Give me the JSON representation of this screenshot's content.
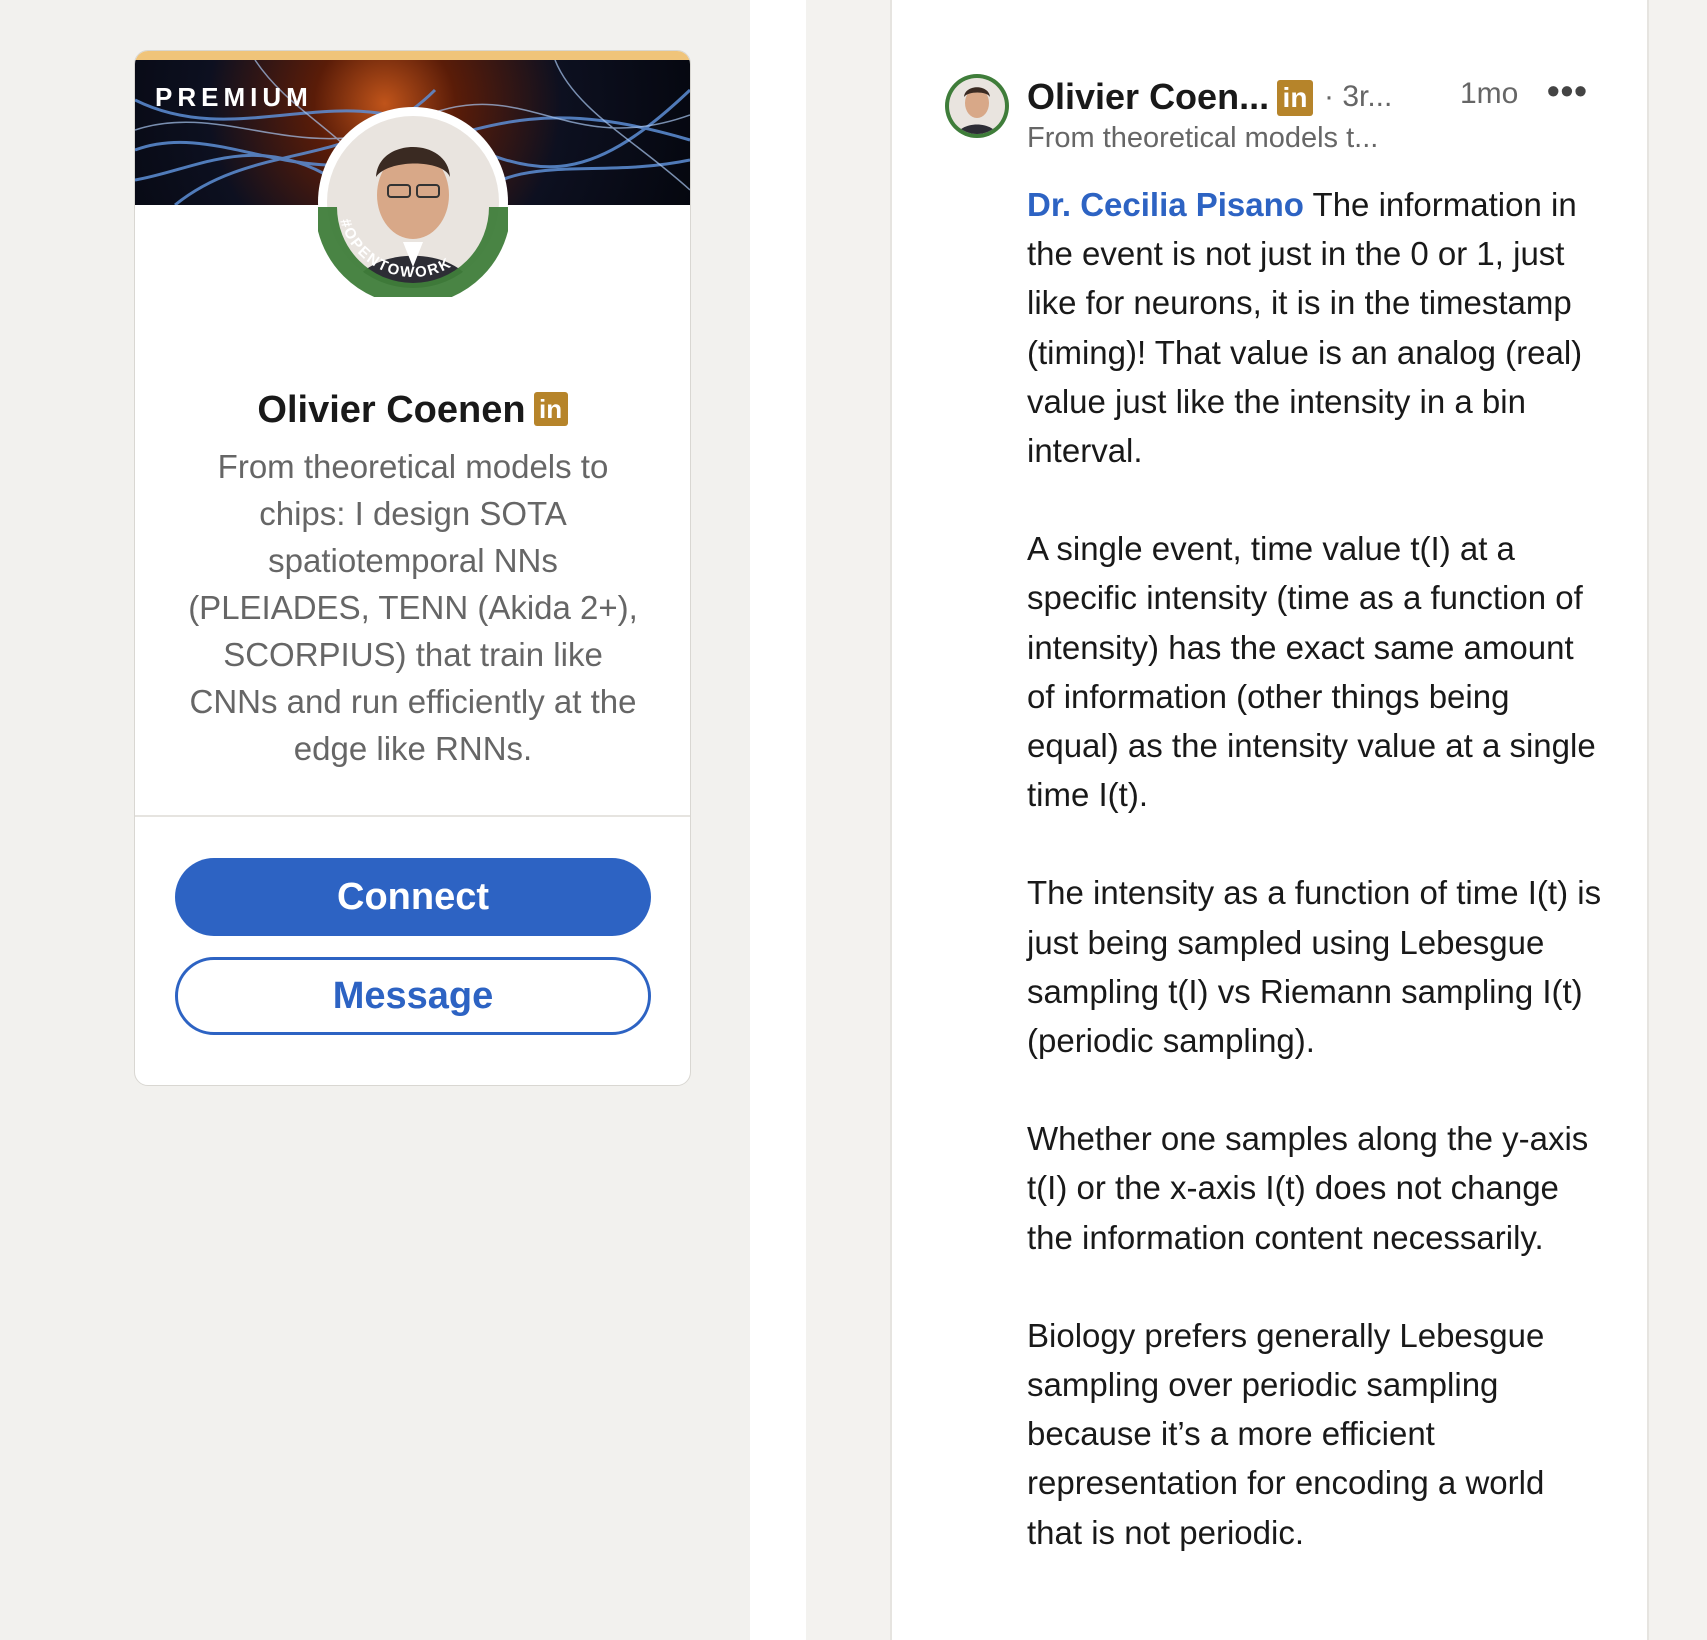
{
  "profile_card": {
    "premium_label": "PREMIUM",
    "avatar_ring_text": "#OPENTOWORK",
    "name": "Olivier Coenen",
    "linkedin_badge": "in",
    "headline": "From theoretical models to chips: I design SOTA spatiotemporal NNs (PLEIADES, TENN (Akida 2+), SCORPIUS) that train like CNNs and run efficiently at the edge like RNNs.",
    "connect_label": "Connect",
    "message_label": "Message"
  },
  "comment": {
    "author_name": "Olivier Coen...",
    "linkedin_badge": "in",
    "degree": "· 3r...",
    "time_ago": "1mo",
    "more_label": "•••",
    "author_headline": "From theoretical models t...",
    "mention": "Dr. Cecilia Pisano",
    "paragraph_1_rest": " The information in the event is not just in the 0 or 1, just like for neurons, it is in the timestamp (timing)! That value is an analog (real) value just like the intensity in a bin interval.",
    "paragraph_2": "A single event, time value t(I) at a specific intensity (time as a function of intensity) has the exact same amount of information (other things being equal) as the intensity value at a single time I(t).",
    "paragraph_3": "The intensity as a function of time I(t) is just being sampled using Lebesgue sampling t(I) vs Riemann sampling I(t) (periodic sampling).",
    "paragraph_4": "Whether one samples along the y-axis t(I) or the x-axis I(t) does not change the information content necessarily.",
    "paragraph_5": "Biology prefers generally Lebesgue sampling over periodic sampling because it’s a more efficient representation for encoding a world that is not periodic."
  },
  "colors": {
    "accent_blue": "#2d63c3",
    "linkedin_gold": "#b6842a",
    "premium_gold": "#f0c47a",
    "opentowork_green": "#3f7d3a"
  }
}
